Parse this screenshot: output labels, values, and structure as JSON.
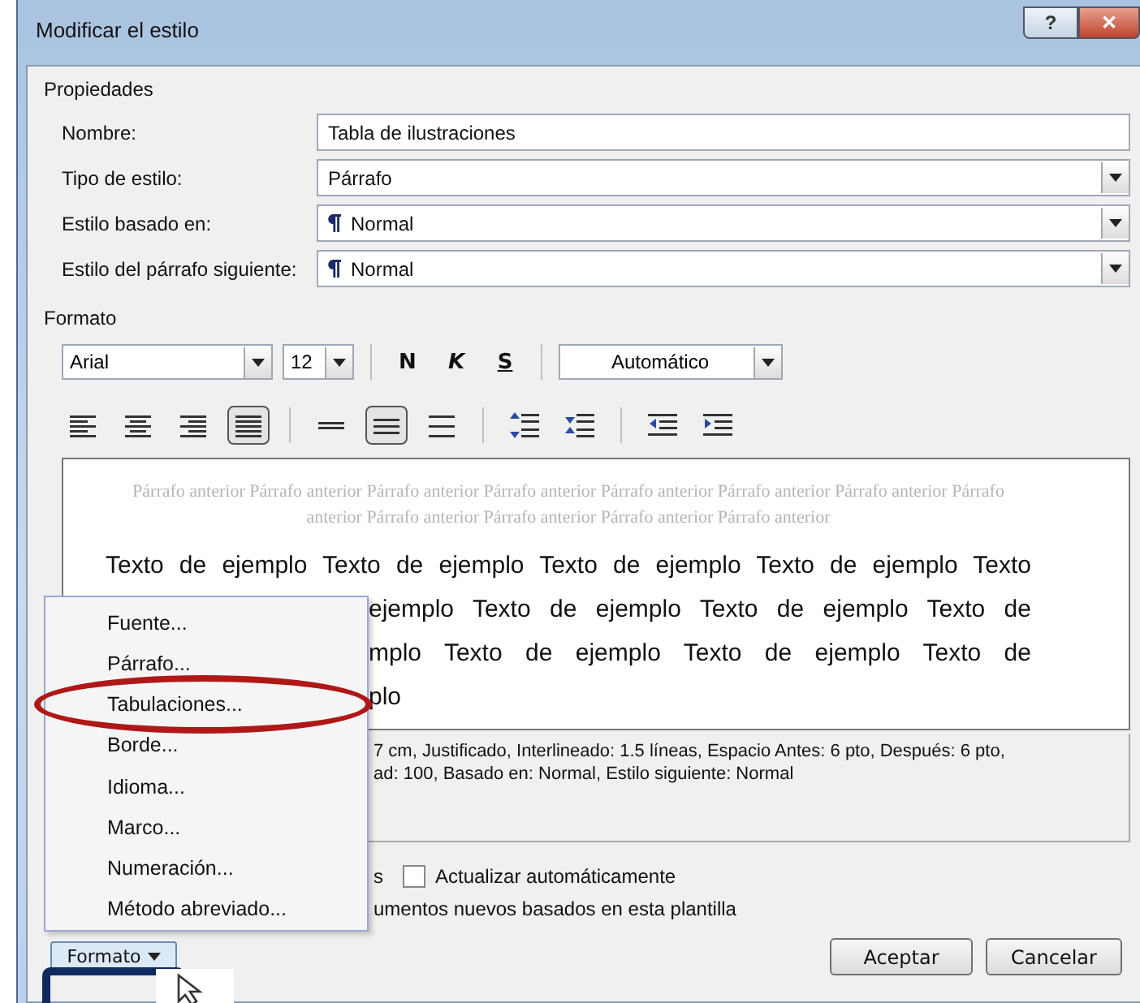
{
  "window": {
    "title": "Modificar el estilo",
    "controls": [
      {
        "kind": "help",
        "label": "?"
      },
      {
        "kind": "close",
        "label": "✕"
      }
    ]
  },
  "properties": {
    "heading": "Propiedades",
    "fields": [
      {
        "label": "Nombre:",
        "kind": "text",
        "value": "Tabla de ilustraciones"
      },
      {
        "label": "Tipo de estilo:",
        "kind": "select",
        "value": "Párrafo",
        "pilcrow": false
      },
      {
        "label": "Estilo basado en:",
        "kind": "select",
        "value": "Normal",
        "pilcrow": true
      },
      {
        "label": "Estilo del párrafo siguiente:",
        "kind": "select",
        "value": "Normal",
        "pilcrow": true
      }
    ]
  },
  "format": {
    "heading": "Formato",
    "font": "Arial",
    "size": "12",
    "styles": [
      {
        "kind": "bold",
        "label": "N"
      },
      {
        "kind": "italic",
        "label": "K"
      },
      {
        "kind": "underline",
        "label": "S"
      }
    ],
    "font_color": "Automático",
    "paragraph_buttons": [
      {
        "kind": "align-left",
        "selected": false
      },
      {
        "kind": "align-center",
        "selected": false
      },
      {
        "kind": "align-right",
        "selected": false
      },
      {
        "kind": "justify",
        "selected": true
      },
      {
        "kind": "single",
        "selected": false
      },
      {
        "kind": "one-half",
        "selected": true
      },
      {
        "kind": "double",
        "selected": false
      },
      {
        "kind": "space-up",
        "selected": false
      },
      {
        "kind": "space-down",
        "selected": false
      },
      {
        "kind": "outdent",
        "selected": false
      },
      {
        "kind": "indent",
        "selected": false
      }
    ]
  },
  "preview": {
    "previous": [
      "Párrafo anterior Párrafo anterior Párrafo anterior Párrafo anterior Párrafo anterior Párrafo anterior Párrafo anterior Párrafo",
      "anterior Párrafo anterior Párrafo anterior Párrafo anterior Párrafo anterior"
    ],
    "sample": [
      {
        "text": "Texto de ejemplo Texto de ejemplo Texto de ejemplo Texto de ejemplo Texto",
        "covered": false,
        "last": false
      },
      {
        "text": "ejemplo Texto de ejemplo Texto de ejemplo Texto de",
        "covered": true,
        "last": false
      },
      {
        "text": "mplo Texto de ejemplo Texto de ejemplo Texto de",
        "covered": true,
        "last": false
      },
      {
        "text": "plo",
        "covered": true,
        "last": true
      }
    ]
  },
  "description": [
    "7 cm, Justificado, Interlineado:  1.5 líneas, Espacio Antes:  6 pto, Después:  6 pto,",
    "ad: 100, Basado en: Normal, Estilo siguiente: Normal"
  ],
  "options": {
    "prefix": "s",
    "auto_update": {
      "label": "Actualizar automáticamente",
      "checked": false
    },
    "new_docs": "umentos nuevos basados en esta plantilla"
  },
  "buttons": {
    "format": "Formato",
    "ok": "Aceptar",
    "cancel": "Cancelar"
  },
  "menu": [
    {
      "label": "Fuente..."
    },
    {
      "label": "Párrafo..."
    },
    {
      "label": "Tabulaciones..."
    },
    {
      "label": "Borde..."
    },
    {
      "label": "Idioma..."
    },
    {
      "label": "Marco..."
    },
    {
      "label": "Numeración..."
    },
    {
      "label": "Método abreviado..."
    }
  ],
  "annotations": {
    "ellipse": true,
    "box": true,
    "cursor": true
  }
}
